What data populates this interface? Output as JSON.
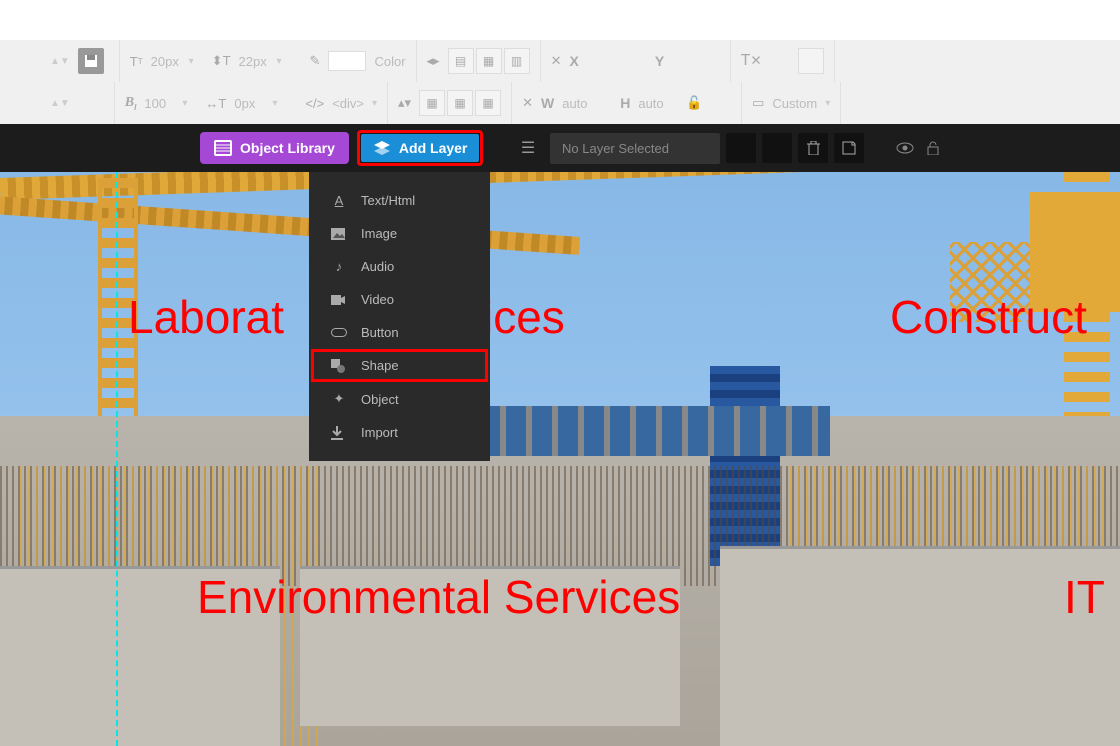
{
  "toolbar_row1": {
    "font_size": "20px",
    "line_height": "22px",
    "color_label": "Color",
    "x_label": "X",
    "y_label": "Y"
  },
  "toolbar_row2": {
    "weight": "100",
    "spacing": "0px",
    "tag": "<div>",
    "w_label": "W",
    "w_val": "auto",
    "h_label": "H",
    "h_val": "auto",
    "preset": "Custom"
  },
  "blackbar": {
    "object_library": "Object Library",
    "add_layer": "Add Layer",
    "no_layer": "No Layer Selected"
  },
  "dropdown": {
    "items": [
      {
        "icon": "A",
        "label": "Text/Html"
      },
      {
        "icon": "▧",
        "label": "Image"
      },
      {
        "icon": "♪",
        "label": "Audio"
      },
      {
        "icon": "■",
        "label": "Video"
      },
      {
        "icon": "⬭",
        "label": "Button"
      },
      {
        "icon": "▛",
        "label": "Shape"
      },
      {
        "icon": "✦",
        "label": "Object"
      },
      {
        "icon": "↓",
        "label": "Import"
      }
    ]
  },
  "canvas_text": {
    "t1": "Laborat",
    "t2": "vices",
    "t3": "Construct",
    "t4": "Environmental Services",
    "t5": "IT"
  }
}
